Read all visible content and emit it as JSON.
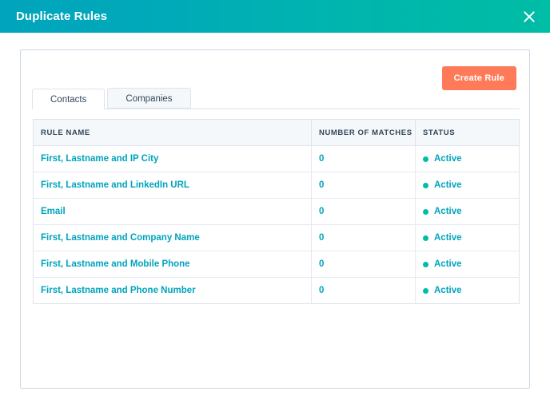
{
  "header": {
    "title": "Duplicate Rules",
    "close_icon": "close-icon",
    "gradient_start": "#00A4BD",
    "gradient_end": "#00BDA5",
    "title_color": "#FFFFFF"
  },
  "toolbar": {
    "create_rule_label": "Create Rule",
    "create_rule_color": "#FF7A59"
  },
  "tabs": [
    {
      "label": "Contacts",
      "active": true
    },
    {
      "label": "Companies",
      "active": false
    }
  ],
  "table": {
    "columns": [
      "RULE NAME",
      "NUMBER OF MATCHES",
      "STATUS"
    ],
    "header_bg": "#F5F8FA",
    "header_color": "#33475B",
    "link_color": "#00A4BD",
    "status_dot_color": "#00BDA5",
    "rows": [
      {
        "rule_name": "First, Lastname and IP City",
        "matches": "0",
        "status": "Active"
      },
      {
        "rule_name": "First, Lastname and LinkedIn URL",
        "matches": "0",
        "status": "Active"
      },
      {
        "rule_name": "Email",
        "matches": "0",
        "status": "Active"
      },
      {
        "rule_name": "First, Lastname and Company Name",
        "matches": "0",
        "status": "Active"
      },
      {
        "rule_name": "First, Lastname and Mobile Phone",
        "matches": "0",
        "status": "Active"
      },
      {
        "rule_name": "First, Lastname and Phone Number",
        "matches": "0",
        "status": "Active"
      }
    ]
  }
}
